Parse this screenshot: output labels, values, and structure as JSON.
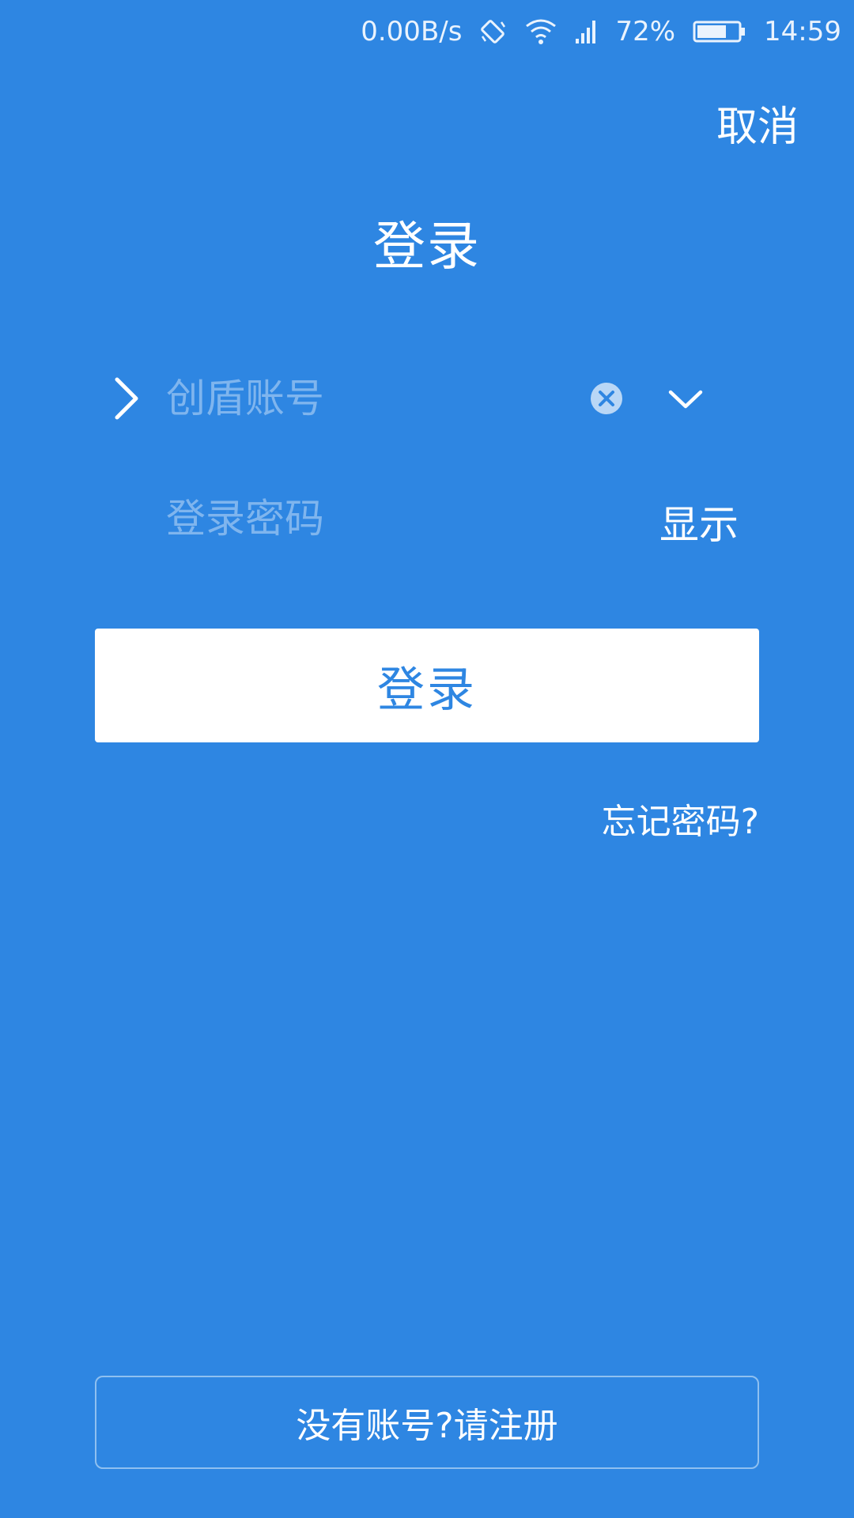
{
  "status_bar": {
    "network_speed": "0.00B/s",
    "battery_percent": "72%",
    "time": "14:59",
    "icons": [
      "rotate-icon",
      "wifi-icon",
      "signal-icon",
      "battery-icon"
    ],
    "battery_level": 0.72
  },
  "header": {
    "cancel_label": "取消",
    "title": "登录"
  },
  "form": {
    "account_placeholder": "创盾账号",
    "account_value": "",
    "password_placeholder": "登录密码",
    "password_value": "",
    "show_label": "显示",
    "login_label": "登录",
    "forgot_label": "忘记密码?"
  },
  "footer": {
    "register_label": "没有账号?请注册"
  },
  "colors": {
    "background": "#2e86e2",
    "button_bg": "#ffffff",
    "button_text": "#2e86e2",
    "placeholder": "#7fb5ee"
  }
}
